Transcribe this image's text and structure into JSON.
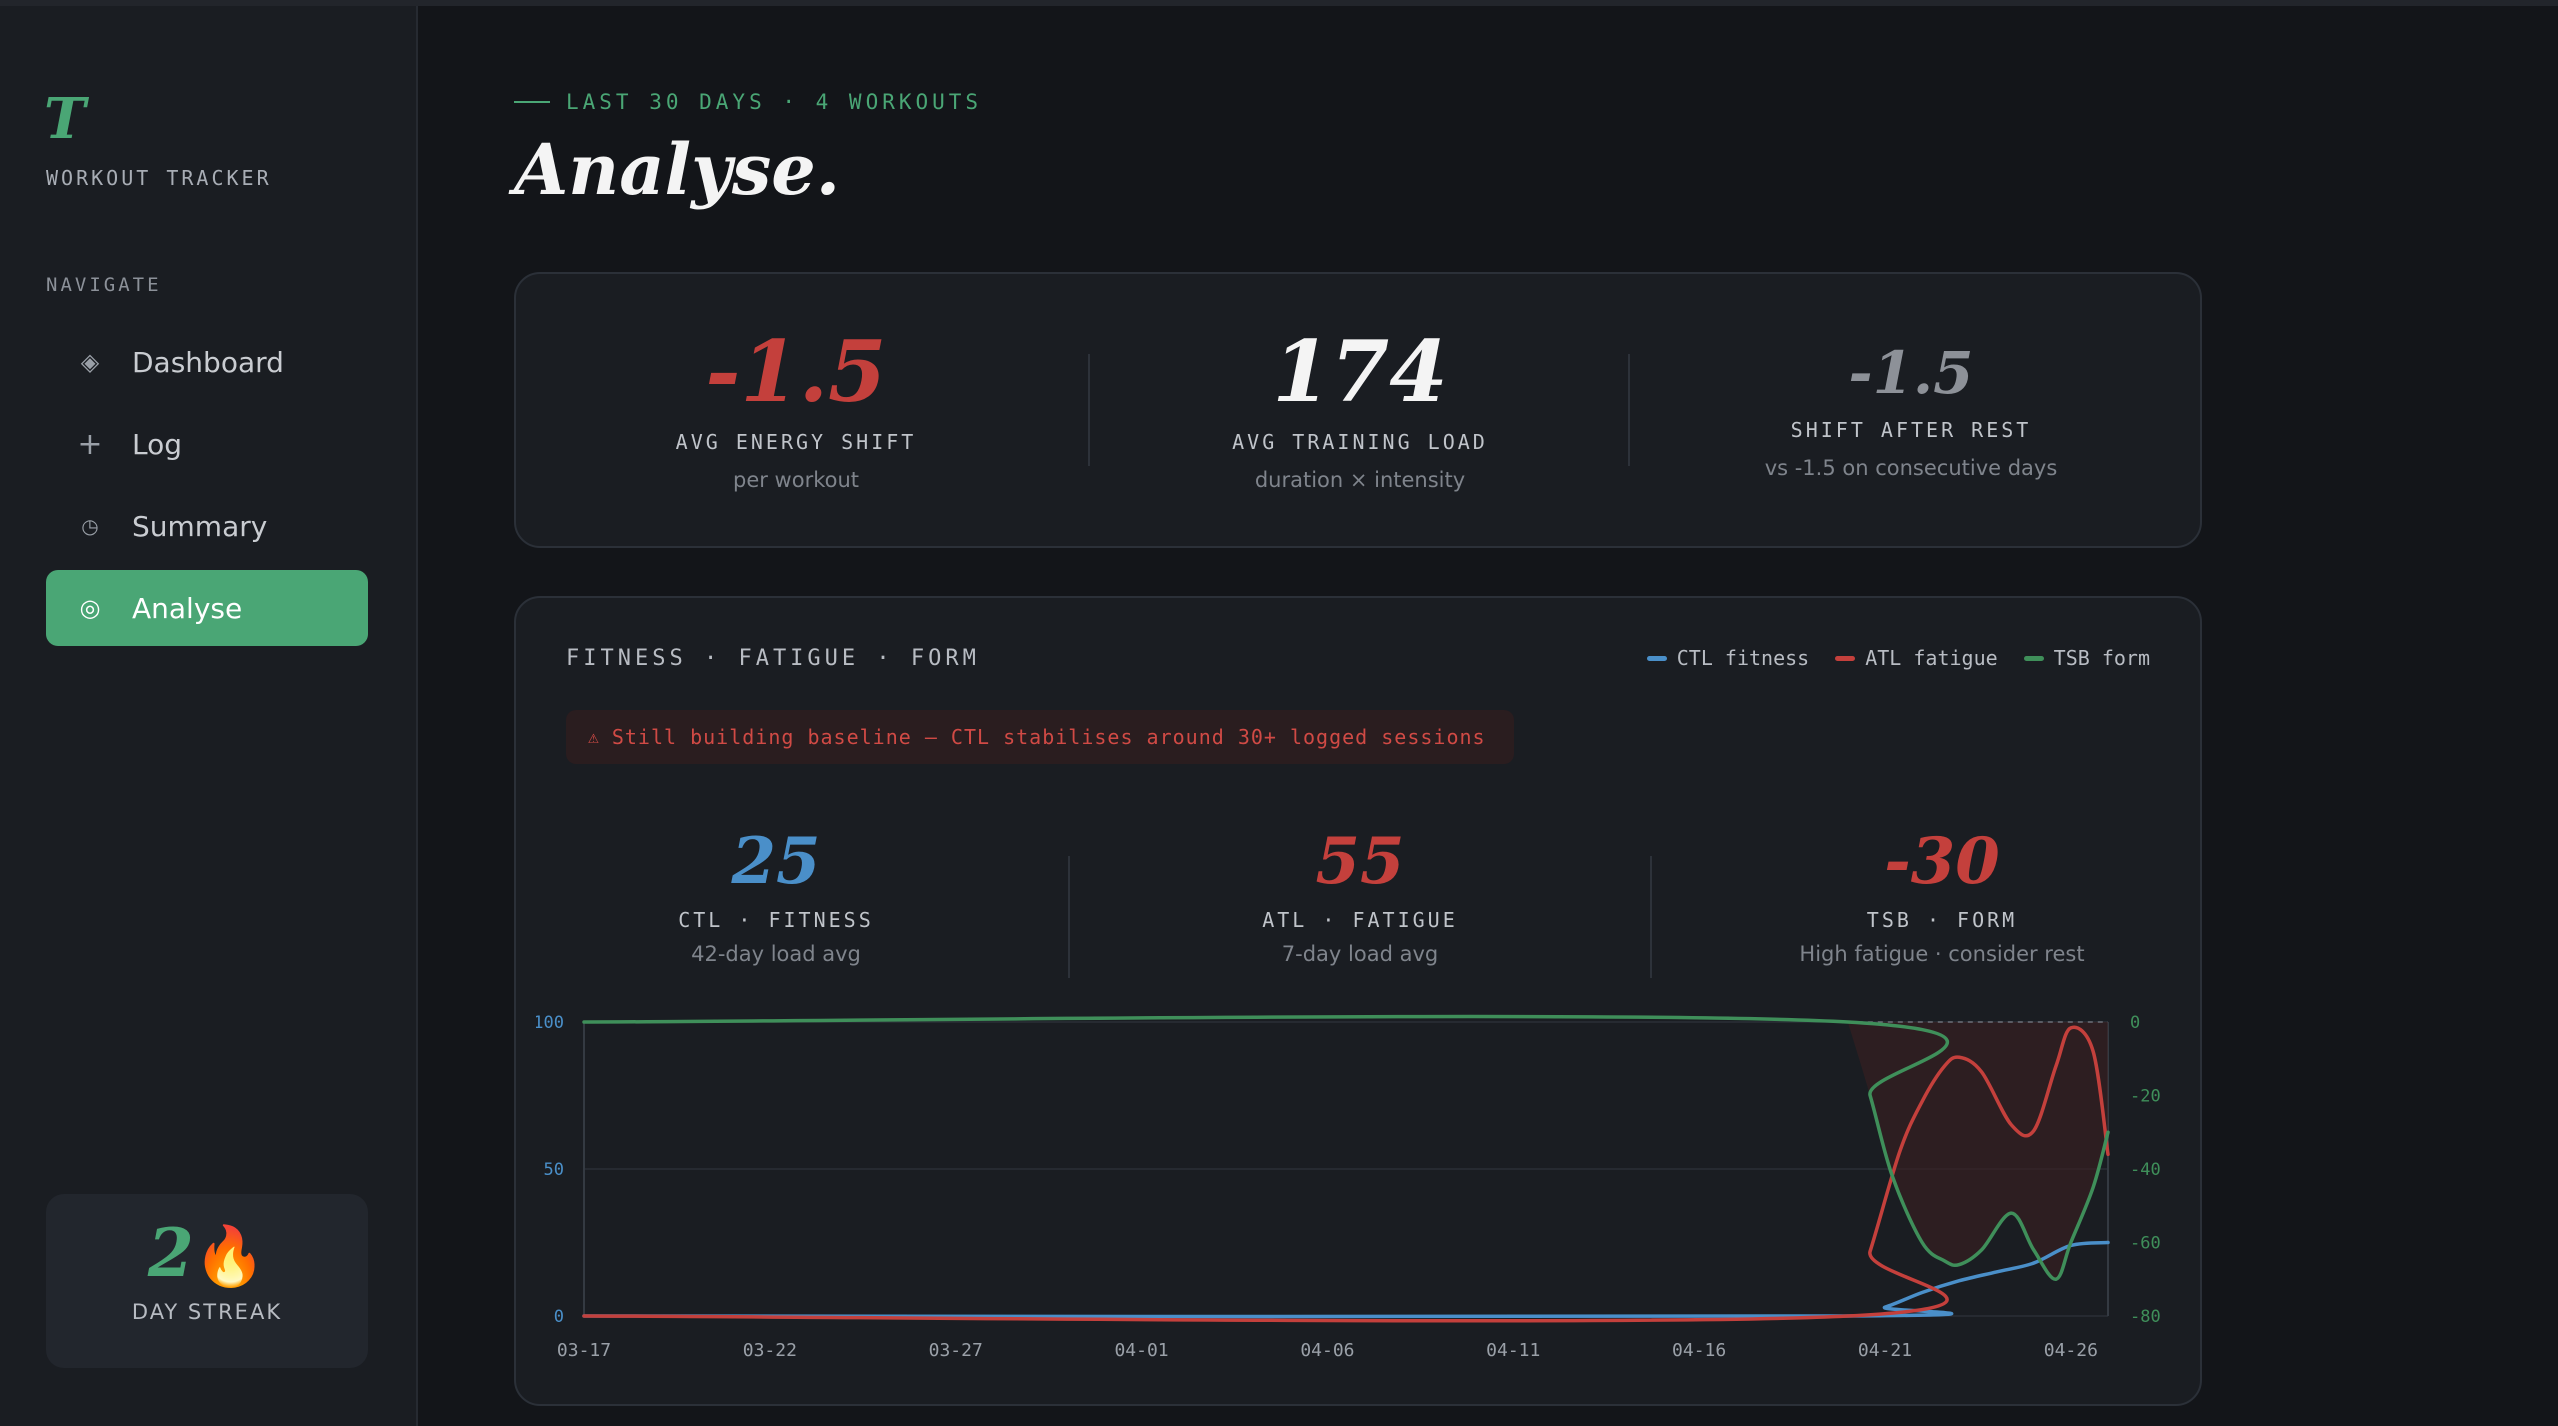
{
  "sidebar": {
    "logo": "T",
    "brand": "WORKOUT TRACKER",
    "nav_title": "NAVIGATE",
    "items": [
      {
        "label": "Dashboard",
        "icon": "diamond-icon"
      },
      {
        "label": "Log",
        "icon": "plus-icon"
      },
      {
        "label": "Summary",
        "icon": "clock-icon"
      },
      {
        "label": "Analyse",
        "icon": "target-icon",
        "active": true
      }
    ],
    "streak": {
      "value": "2",
      "emoji": "🔥",
      "label": "DAY STREAK"
    }
  },
  "header": {
    "eyebrow": "LAST 30 DAYS · 4 WORKOUTS",
    "title": "Analyse."
  },
  "stats": [
    {
      "value": "-1.5",
      "label": "AVG ENERGY SHIFT",
      "sub": "per workout",
      "color": "#c4403c"
    },
    {
      "value": "174",
      "label": "AVG TRAINING LOAD",
      "sub": "duration × intensity",
      "color": "#f4f4f4"
    },
    {
      "value": "-1.5",
      "label": "SHIFT AFTER REST",
      "sub": "vs -1.5 on consecutive days",
      "color": "#8d9198"
    }
  ],
  "fitness_panel": {
    "title": "FITNESS · FATIGUE · FORM",
    "legend": [
      {
        "label": "CTL fitness",
        "color": "#4a8fc9"
      },
      {
        "label": "ATL fatigue",
        "color": "#c4403c"
      },
      {
        "label": "TSB form",
        "color": "#3f8f5a"
      }
    ],
    "warning": "Still building baseline — CTL stabilises around 30+ logged sessions",
    "warning_icon": "warning-icon",
    "metrics": [
      {
        "value": "25",
        "label": "CTL · FITNESS",
        "sub": "42-day load avg",
        "color": "#4a8fc9"
      },
      {
        "value": "55",
        "label": "ATL · FATIGUE",
        "sub": "7-day load avg",
        "color": "#c4403c"
      },
      {
        "value": "-30",
        "label": "TSB · FORM",
        "sub": "High fatigue · consider rest",
        "color": "#c4403c"
      }
    ]
  },
  "chart_data": {
    "type": "line",
    "x_ticks": [
      "03-17",
      "03-22",
      "03-27",
      "04-01",
      "04-06",
      "04-11",
      "04-16",
      "04-21",
      "04-26"
    ],
    "y_left": {
      "ticks": [
        0,
        50,
        100
      ],
      "range": [
        0,
        100
      ],
      "color": "#4a8fc9"
    },
    "y_right": {
      "ticks": [
        0,
        -20,
        -40,
        -60,
        -80
      ],
      "range": [
        -80,
        0
      ],
      "color": "#3f8f5a"
    },
    "x_range": [
      0,
      41
    ],
    "grid": true,
    "series": [
      {
        "name": "CTL fitness",
        "axis": "left",
        "color": "#4a8fc9",
        "points": [
          [
            0,
            0
          ],
          [
            34,
            0
          ],
          [
            35,
            3
          ],
          [
            36,
            8
          ],
          [
            37,
            12
          ],
          [
            38,
            15
          ],
          [
            39,
            18
          ],
          [
            40,
            24
          ],
          [
            41,
            25
          ]
        ]
      },
      {
        "name": "ATL fatigue",
        "axis": "left",
        "color": "#c4403c",
        "points": [
          [
            0,
            0
          ],
          [
            34,
            0
          ],
          [
            34.6,
            22
          ],
          [
            35.4,
            56
          ],
          [
            36,
            73
          ],
          [
            36.6,
            85
          ],
          [
            37,
            88
          ],
          [
            37.6,
            83
          ],
          [
            38.4,
            65
          ],
          [
            39,
            63
          ],
          [
            39.6,
            85
          ],
          [
            40,
            98
          ],
          [
            40.6,
            90
          ],
          [
            41,
            55
          ]
        ]
      },
      {
        "name": "TSB form",
        "axis": "right",
        "color": "#3f8f5a",
        "points": [
          [
            0,
            0
          ],
          [
            34,
            0
          ],
          [
            34.6,
            -20
          ],
          [
            35.2,
            -42
          ],
          [
            36,
            -60
          ],
          [
            36.6,
            -65
          ],
          [
            37,
            -66
          ],
          [
            37.6,
            -62
          ],
          [
            38.4,
            -52
          ],
          [
            39,
            -62
          ],
          [
            39.6,
            -70
          ],
          [
            40,
            -60
          ],
          [
            40.6,
            -45
          ],
          [
            41,
            -30
          ]
        ]
      }
    ]
  }
}
